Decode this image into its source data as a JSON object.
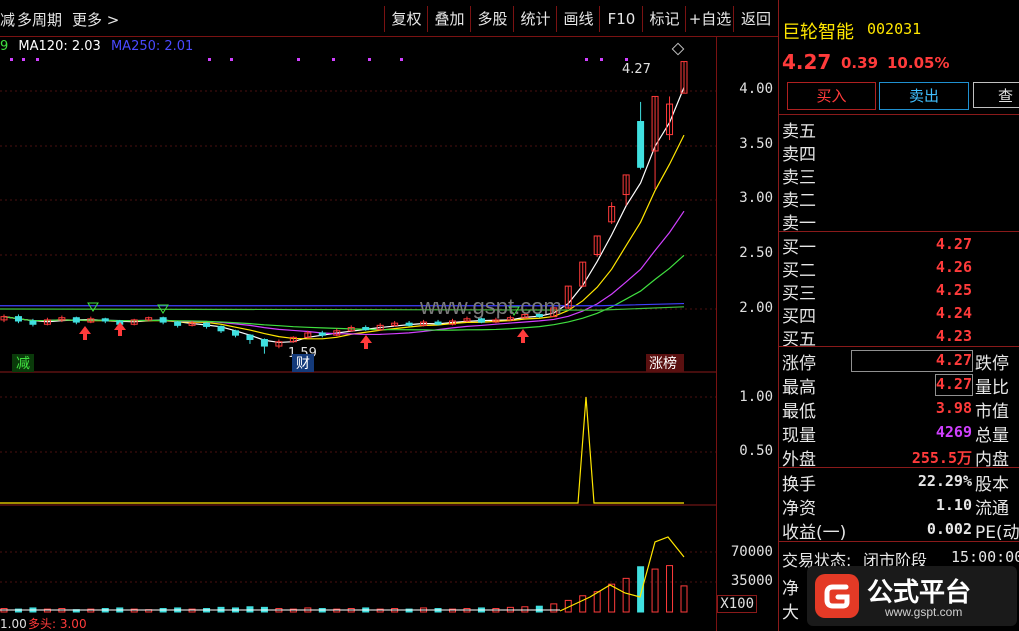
{
  "toolbar": {
    "left_cut": "减",
    "period": "多周期",
    "more": "更多 >",
    "buttons": [
      "复权",
      "叠加",
      "多股",
      "统计",
      "画线",
      "F10",
      "标记",
      "+自选",
      "返回"
    ]
  },
  "ma": {
    "ma120_label": "MA120: 2.03",
    "ma250_label": "MA250: 2.01",
    "left_cut": "9",
    "ma120_color": "#ffffff",
    "ma250_color": "#4040ff"
  },
  "chart": {
    "price_ticks": [
      "4.00",
      "3.50",
      "3.00",
      "2.50",
      "2.00"
    ],
    "ind_ticks": [
      "1.00",
      "0.50"
    ],
    "vol_ticks": [
      "70000",
      "35000"
    ],
    "vol_unit": "X100",
    "high_mark": "4.27",
    "low_mark": "1.59",
    "watermark": "www.gspt.com",
    "tag_left": "减",
    "tag_cai": "财",
    "tag_zhangbang": "涨榜",
    "bottom_label": "多头: 3.00",
    "bottom_left": "1.00",
    "up_color": "#ff3b3b",
    "down_color": "#40e0e0",
    "series": {
      "price_candles": [
        {
          "o": 1.9,
          "c": 1.93,
          "h": 1.95,
          "l": 1.88
        },
        {
          "o": 1.93,
          "c": 1.89,
          "h": 1.95,
          "l": 1.87
        },
        {
          "o": 1.89,
          "c": 1.86,
          "h": 1.91,
          "l": 1.84
        },
        {
          "o": 1.86,
          "c": 1.9,
          "h": 1.92,
          "l": 1.85
        },
        {
          "o": 1.9,
          "c": 1.92,
          "h": 1.94,
          "l": 1.88
        },
        {
          "o": 1.92,
          "c": 1.88,
          "h": 1.93,
          "l": 1.86
        },
        {
          "o": 1.88,
          "c": 1.91,
          "h": 1.93,
          "l": 1.87
        },
        {
          "o": 1.91,
          "c": 1.89,
          "h": 1.92,
          "l": 1.87
        },
        {
          "o": 1.89,
          "c": 1.86,
          "h": 1.9,
          "l": 1.84
        },
        {
          "o": 1.86,
          "c": 1.9,
          "h": 1.91,
          "l": 1.85
        },
        {
          "o": 1.9,
          "c": 1.92,
          "h": 1.93,
          "l": 1.89
        },
        {
          "o": 1.92,
          "c": 1.88,
          "h": 1.93,
          "l": 1.86
        },
        {
          "o": 1.88,
          "c": 1.85,
          "h": 1.89,
          "l": 1.83
        },
        {
          "o": 1.85,
          "c": 1.87,
          "h": 1.89,
          "l": 1.84
        },
        {
          "o": 1.87,
          "c": 1.84,
          "h": 1.88,
          "l": 1.82
        },
        {
          "o": 1.84,
          "c": 1.8,
          "h": 1.85,
          "l": 1.78
        },
        {
          "o": 1.8,
          "c": 1.76,
          "h": 1.81,
          "l": 1.74
        },
        {
          "o": 1.76,
          "c": 1.72,
          "h": 1.77,
          "l": 1.68
        },
        {
          "o": 1.72,
          "c": 1.66,
          "h": 1.73,
          "l": 1.59
        },
        {
          "o": 1.66,
          "c": 1.7,
          "h": 1.72,
          "l": 1.64
        },
        {
          "o": 1.7,
          "c": 1.74,
          "h": 1.75,
          "l": 1.69
        },
        {
          "o": 1.74,
          "c": 1.78,
          "h": 1.8,
          "l": 1.73
        },
        {
          "o": 1.78,
          "c": 1.76,
          "h": 1.8,
          "l": 1.74
        },
        {
          "o": 1.76,
          "c": 1.8,
          "h": 1.82,
          "l": 1.75
        },
        {
          "o": 1.8,
          "c": 1.83,
          "h": 1.85,
          "l": 1.79
        },
        {
          "o": 1.83,
          "c": 1.81,
          "h": 1.85,
          "l": 1.8
        },
        {
          "o": 1.81,
          "c": 1.85,
          "h": 1.87,
          "l": 1.8
        },
        {
          "o": 1.85,
          "c": 1.87,
          "h": 1.89,
          "l": 1.84
        },
        {
          "o": 1.87,
          "c": 1.85,
          "h": 1.89,
          "l": 1.84
        },
        {
          "o": 1.85,
          "c": 1.88,
          "h": 1.9,
          "l": 1.84
        },
        {
          "o": 1.88,
          "c": 1.86,
          "h": 1.9,
          "l": 1.85
        },
        {
          "o": 1.86,
          "c": 1.89,
          "h": 1.91,
          "l": 1.85
        },
        {
          "o": 1.89,
          "c": 1.91,
          "h": 1.93,
          "l": 1.88
        },
        {
          "o": 1.91,
          "c": 1.88,
          "h": 1.92,
          "l": 1.87
        },
        {
          "o": 1.88,
          "c": 1.9,
          "h": 1.92,
          "l": 1.87
        },
        {
          "o": 1.9,
          "c": 1.92,
          "h": 1.94,
          "l": 1.89
        },
        {
          "o": 1.92,
          "c": 1.95,
          "h": 1.97,
          "l": 1.91
        },
        {
          "o": 1.95,
          "c": 1.93,
          "h": 1.97,
          "l": 1.92
        },
        {
          "o": 1.93,
          "c": 2.01,
          "h": 2.02,
          "l": 1.93
        },
        {
          "o": 2.01,
          "c": 2.21,
          "h": 2.21,
          "l": 2.0
        },
        {
          "o": 2.21,
          "c": 2.43,
          "h": 2.43,
          "l": 2.2
        },
        {
          "o": 2.5,
          "c": 2.67,
          "h": 2.67,
          "l": 2.48
        },
        {
          "o": 2.8,
          "c": 2.94,
          "h": 2.98,
          "l": 2.78
        },
        {
          "o": 3.05,
          "c": 3.23,
          "h": 3.23,
          "l": 2.95
        },
        {
          "o": 3.72,
          "c": 3.3,
          "h": 3.9,
          "l": 3.28
        },
        {
          "o": 3.45,
          "c": 3.95,
          "h": 3.95,
          "l": 3.1
        },
        {
          "o": 3.6,
          "c": 3.88,
          "h": 3.95,
          "l": 3.55
        },
        {
          "o": 3.98,
          "c": 4.27,
          "h": 4.27,
          "l": 3.98
        }
      ],
      "volume": [
        6,
        5,
        7,
        5,
        6,
        4,
        5,
        6,
        7,
        5,
        4,
        6,
        7,
        5,
        6,
        8,
        7,
        9,
        8,
        6,
        5,
        7,
        6,
        5,
        6,
        7,
        5,
        6,
        5,
        7,
        6,
        5,
        6,
        7,
        6,
        8,
        9,
        10,
        14,
        20,
        28,
        35,
        48,
        58,
        78,
        74,
        80,
        45
      ]
    }
  },
  "stock": {
    "name": "巨轮智能",
    "code": "002031",
    "price": "4.27",
    "change": "0.39",
    "pct": "10.05%",
    "buy_btn": "买入",
    "sell_btn": "卖出",
    "query_btn": "查",
    "asks": [
      "卖五",
      "卖四",
      "卖三",
      "卖二",
      "卖一"
    ],
    "bids": [
      {
        "label": "买一",
        "price": "4.27"
      },
      {
        "label": "买二",
        "price": "4.26"
      },
      {
        "label": "买三",
        "price": "4.25"
      },
      {
        "label": "买四",
        "price": "4.24"
      },
      {
        "label": "买五",
        "price": "4.23"
      }
    ],
    "stats": [
      {
        "label": "涨停",
        "value": "4.27",
        "right": "跌停",
        "color": "#ff3b3b",
        "boxed": true
      },
      {
        "label": "最高",
        "value": "4.27",
        "right": "量比",
        "color": "#ff3b3b",
        "boxed": true
      },
      {
        "label": "最低",
        "value": "3.98",
        "right": "市值",
        "color": "#ff3b3b",
        "boxed": false
      },
      {
        "label": "现量",
        "value": "4269",
        "right": "总量",
        "color": "#d040ff",
        "boxed": false
      },
      {
        "label": "外盘",
        "value": "255.5万",
        "right": "内盘",
        "color": "#ff3b3b",
        "boxed": false
      }
    ],
    "stats2": [
      {
        "label": "换手",
        "value": "22.29%",
        "right": "股本"
      },
      {
        "label": "净资",
        "value": "1.10",
        "right": "流通"
      },
      {
        "label": "收益(一)",
        "value": "0.002",
        "right": "PE(动"
      }
    ],
    "trade_state_label": "交易状态:",
    "trade_state": "闭市阶段",
    "trade_time": "15:00:00",
    "cut1": "净",
    "cut2": "大",
    "logo_text": "公式平台",
    "logo_url": "www.gspt.com"
  }
}
